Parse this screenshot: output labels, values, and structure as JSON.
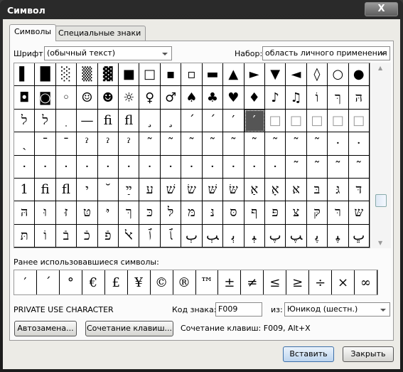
{
  "window": {
    "title": "Символ",
    "close": "X"
  },
  "tabs": [
    {
      "label": "Символы",
      "active": true
    },
    {
      "label": "Специальные знаки",
      "active": false
    }
  ],
  "font": {
    "label": "Шрифт:",
    "value": "(обычный текст)"
  },
  "subset": {
    "label": "Набор:",
    "value": "область личного применения"
  },
  "grid": [
    [
      "▌",
      "█",
      "░",
      "▒",
      "▓",
      "■",
      "□",
      "▪",
      "▫",
      "▬",
      "▲",
      "►",
      "▼",
      "◄",
      "◊",
      "○",
      "●"
    ],
    [
      "◘",
      "◙",
      "◦",
      "☺",
      "☻",
      "☼",
      "♀",
      "♂",
      "♠",
      "♣",
      "♥",
      "♦",
      "♪",
      "♫",
      "וֹ",
      "ךּ",
      "הּ"
    ],
    [
      "ל",
      "ל",
      "ֽ",
      "—",
      "ﬁ",
      "ﬂ",
      "¸",
      "¸",
      "ˊ",
      "ˊ",
      "′",
      "′",
      "□",
      "□",
      "□",
      "□",
      "□"
    ],
    [
      "ˎ",
      "ˉ",
      "ˉ",
      "ˀ",
      "ˀ",
      "ˀ",
      "˜",
      "˜",
      "˜",
      "˜",
      "˜",
      "˜",
      "˜",
      "˜",
      "˜",
      "·",
      "·"
    ],
    [
      "·",
      "·",
      "·",
      "·",
      "·",
      "·",
      "·",
      "·",
      "·",
      "·",
      "·",
      "·",
      "·",
      "˜",
      "˜",
      "˜",
      "˜"
    ],
    [
      "1",
      "ﬁ",
      "ﬂ",
      "י",
      "˘",
      "ײַ",
      "ע",
      "שׁ",
      "שׂ",
      "שּׁ",
      "שּׂ",
      "אַ",
      "אָ",
      "אּ",
      "בּ",
      "גּ",
      "דּ"
    ],
    [
      "הּ",
      "וּ",
      "זּ",
      "טּ",
      "יּ",
      "ךּ",
      "כּ",
      "לּ",
      "מּ",
      "נּ",
      "סּ",
      "ףּ",
      "פּ",
      "צּ",
      "קּ",
      "רּ",
      "שּ"
    ],
    [
      "תּ",
      "וֹ",
      "בֿ",
      "כֿ",
      "פֿ",
      "ﭏ",
      "ﭐ",
      "ﭑ",
      "ﭒ",
      "ﭓ",
      "ﭔ",
      "ﭕ",
      "ﭖ",
      "ﭗ",
      "ﭘ",
      "ﭙ",
      "ﭚ"
    ]
  ],
  "selected_cell": {
    "row": 2,
    "col": 11
  },
  "recent": {
    "label": "Ранее использовавшиеся символы:",
    "symbols": [
      "′",
      "ˊ",
      "°",
      "€",
      "£",
      "¥",
      "©",
      "®",
      "™",
      "±",
      "≠",
      "≤",
      "≥",
      "÷",
      "×",
      "∞",
      "µ"
    ]
  },
  "char_name": "PRIVATE USE CHARACTER",
  "code": {
    "label": "Код знака:",
    "value": "F009"
  },
  "from": {
    "label": "из:",
    "value": "Юникод (шестн.)"
  },
  "buttons": {
    "autocorrect": "Автозамена...",
    "shortcut": "Сочетание клавиш...",
    "insert": "Вставить",
    "close": "Закрыть"
  },
  "shortcut_text": "Сочетание клавиш: F009, Alt+X"
}
